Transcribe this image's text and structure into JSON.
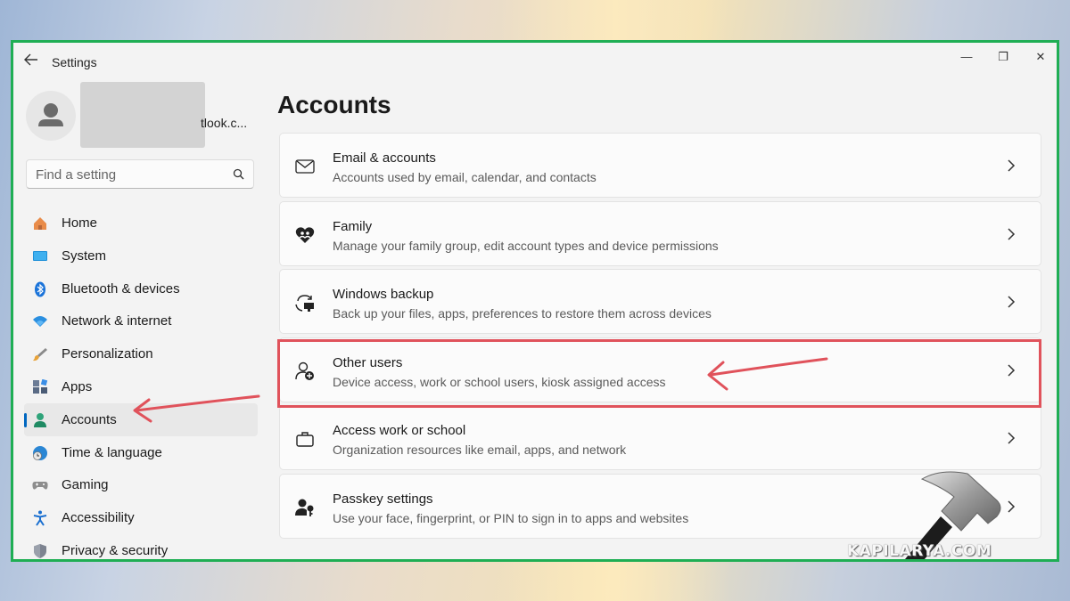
{
  "window": {
    "title": "Settings",
    "minimize": "—",
    "maximize": "❐",
    "close": "✕"
  },
  "profile": {
    "email_fragment": "tlook.c..."
  },
  "search": {
    "placeholder": "Find a setting"
  },
  "sidebar": {
    "items": [
      {
        "label": "Home",
        "icon": "home-icon"
      },
      {
        "label": "System",
        "icon": "monitor-icon"
      },
      {
        "label": "Bluetooth & devices",
        "icon": "bluetooth-icon"
      },
      {
        "label": "Network & internet",
        "icon": "wifi-icon"
      },
      {
        "label": "Personalization",
        "icon": "brush-icon"
      },
      {
        "label": "Apps",
        "icon": "apps-icon"
      },
      {
        "label": "Accounts",
        "icon": "person-icon",
        "active": true
      },
      {
        "label": "Time & language",
        "icon": "globe-clock-icon"
      },
      {
        "label": "Gaming",
        "icon": "gamepad-icon"
      },
      {
        "label": "Accessibility",
        "icon": "accessibility-icon"
      },
      {
        "label": "Privacy & security",
        "icon": "shield-icon"
      }
    ]
  },
  "main": {
    "title": "Accounts",
    "cards": [
      {
        "title": "Email & accounts",
        "description": "Accounts used by email, calendar, and contacts",
        "icon": "mail-icon"
      },
      {
        "title": "Family",
        "description": "Manage your family group, edit account types and device permissions",
        "icon": "family-heart-icon"
      },
      {
        "title": "Windows backup",
        "description": "Back up your files, apps, preferences to restore them across devices",
        "icon": "backup-icon"
      },
      {
        "title": "Other users",
        "description": "Device access, work or school users, kiosk assigned access",
        "icon": "add-user-icon",
        "highlighted": true
      },
      {
        "title": "Access work or school",
        "description": "Organization resources like email, apps, and network",
        "icon": "briefcase-icon"
      },
      {
        "title": "Passkey settings",
        "description": "Use your face, fingerprint, or PIN to sign in to apps and websites",
        "icon": "passkey-icon"
      }
    ]
  },
  "colors": {
    "accent": "#0067c0",
    "annotation": "#e0525b",
    "frame": "#1fae54"
  },
  "watermark": "KAPILARYA.COM"
}
